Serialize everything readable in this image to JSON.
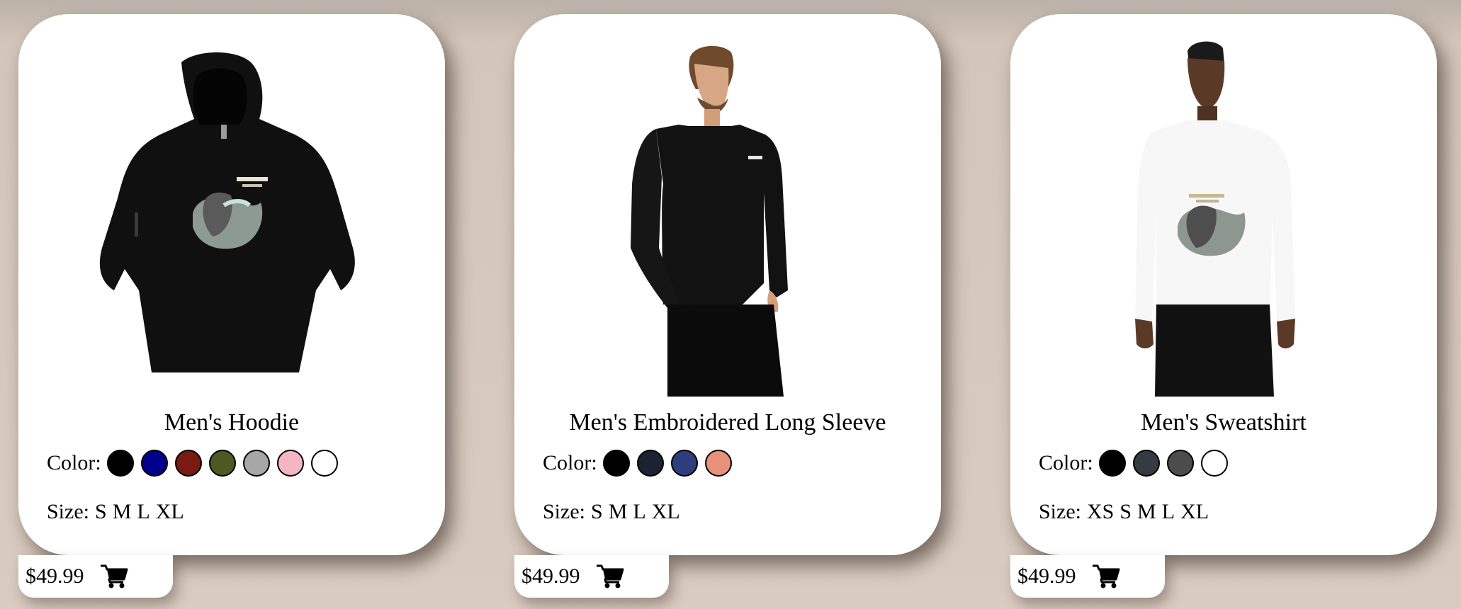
{
  "products": [
    {
      "name": "Men's Hoodie",
      "color_label": "Color:",
      "colors": [
        "#000000",
        "#00008b",
        "#7b1a12",
        "#4a5a22",
        "#a7a7a7",
        "#f4b6c2",
        "#ffffff"
      ],
      "size_label": "Size:",
      "sizes": [
        "S",
        "M",
        "L",
        "XL"
      ],
      "price": "$49.99",
      "image": "black-hoodie-photo",
      "cart_icon": "cart-icon"
    },
    {
      "name": "Men's Embroidered Long Sleeve",
      "color_label": "Color:",
      "colors": [
        "#000000",
        "#1b2231",
        "#2e3e7c",
        "#e7917a"
      ],
      "size_label": "Size:",
      "sizes": [
        "S",
        "M",
        "L",
        "XL"
      ],
      "price": "$49.99",
      "image": "man-in-black-long-sleeve-photo",
      "cart_icon": "cart-icon"
    },
    {
      "name": "Men's Sweatshirt",
      "color_label": "Color:",
      "colors": [
        "#000000",
        "#343b43",
        "#4c4c4c",
        "#ffffff"
      ],
      "size_label": "Size:",
      "sizes": [
        "XS",
        "S",
        "M",
        "L",
        "XL"
      ],
      "price": "$49.99",
      "image": "man-in-white-sweatshirt-photo",
      "cart_icon": "cart-icon"
    }
  ]
}
